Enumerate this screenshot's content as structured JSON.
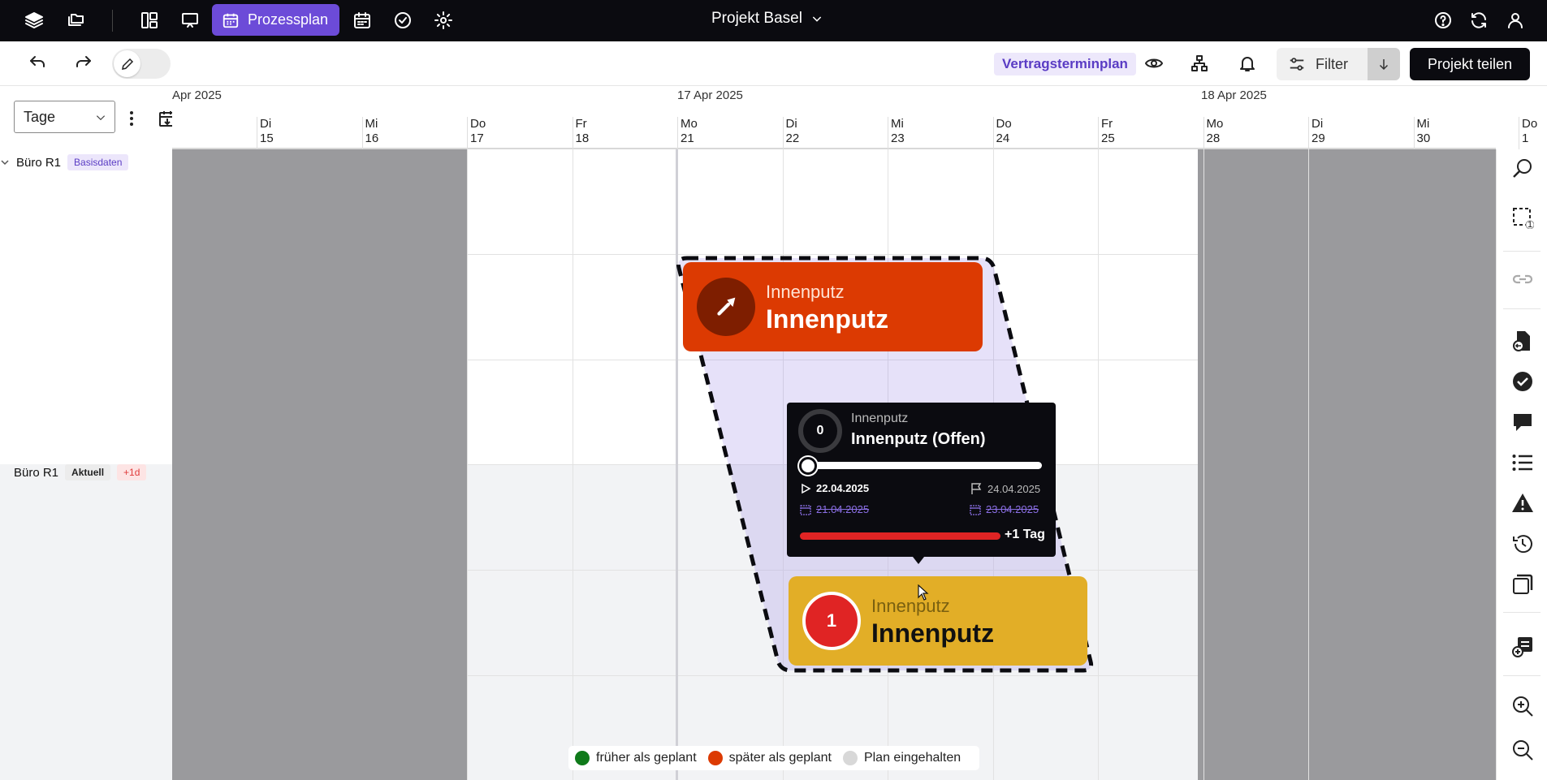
{
  "topbar": {
    "active_tab_label": "Prozessplan",
    "project_title": "Projekt Basel"
  },
  "toolbar": {
    "view_badge": "Vertragsterminplan",
    "filter_label": "Filter",
    "share_label": "Projekt teilen"
  },
  "left_panel": {
    "unit_select_value": "Tage",
    "rows": [
      {
        "label": "Büro R1",
        "badges": [
          "Basisdaten"
        ]
      },
      {
        "label": "Büro R1",
        "badges": [
          "Aktuell",
          "+1d"
        ]
      }
    ]
  },
  "timeline": {
    "months": [
      "Apr 2025",
      "17 Apr 2025",
      "18 Apr 2025"
    ],
    "days": [
      {
        "weekday": "Di",
        "day": "15"
      },
      {
        "weekday": "Mi",
        "day": "16"
      },
      {
        "weekday": "Do",
        "day": "17"
      },
      {
        "weekday": "Fr",
        "day": "18"
      },
      {
        "weekday": "Mo",
        "day": "21"
      },
      {
        "weekday": "Di",
        "day": "22"
      },
      {
        "weekday": "Mi",
        "day": "23"
      },
      {
        "weekday": "Do",
        "day": "24"
      },
      {
        "weekday": "Fr",
        "day": "25"
      },
      {
        "weekday": "Mo",
        "day": "28"
      },
      {
        "weekday": "Di",
        "day": "29"
      },
      {
        "weekday": "Mi",
        "day": "30"
      },
      {
        "weekday": "Do",
        "day": "1"
      }
    ]
  },
  "cards": {
    "planned": {
      "subtitle": "Innenputz",
      "title": "Innenputz",
      "color": "#dc3a02"
    },
    "actual": {
      "subtitle": "Innenputz",
      "title": "Innenputz",
      "number": "1",
      "color": "#e2ae27"
    }
  },
  "tooltip": {
    "progress_count": "0",
    "subtitle": "Innenputz",
    "title": "Innenputz (Offen)",
    "start_date": "22.04.2025",
    "end_date": "24.04.2025",
    "planned_start": "21.04.2025",
    "planned_end": "23.04.2025",
    "delay_label": "+1 Tag",
    "progress_fraction": 0
  },
  "right_sidebar": {
    "selection_count": "1"
  },
  "legend": {
    "items": [
      {
        "label": "früher als geplant",
        "color": "#0f7a1a"
      },
      {
        "label": "später als geplant",
        "color": "#dc3a02"
      },
      {
        "label": "Plan eingehalten",
        "color": "#d8d8d8"
      }
    ]
  }
}
